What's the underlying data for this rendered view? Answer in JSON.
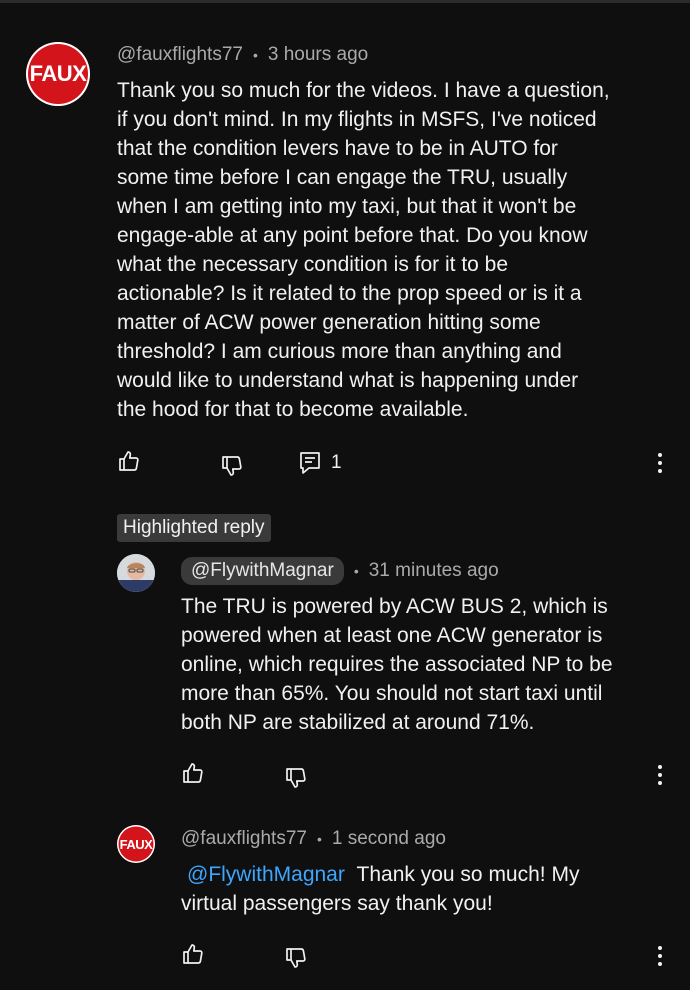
{
  "comment": {
    "avatar_text": "FAUX",
    "handle": "@fauxflights77",
    "time": "3 hours ago",
    "text": "Thank you so much for the videos. I have a question,\nif you don't mind. In my flights in MSFS, I've noticed\nthat the condition levers have to be in AUTO for\nsome time before I can engage the TRU, usually\nwhen I am getting into my taxi, but that it won't be\nengage-able at any point before that. Do you know\nwhat the necessary condition is for it to be\nactionable? Is it related to the prop speed or is it a\nmatter of ACW power generation hitting some\nthreshold? I am curious more than anything and\nwould like to understand what is happening under\nthe hood for that to become available.",
    "reply_count": "1"
  },
  "highlighted_label": "Highlighted reply",
  "reply1": {
    "handle": "@FlywithMagnar",
    "time": "31 minutes ago",
    "text": "The TRU is powered by ACW BUS 2, which is\npowered when at least one ACW generator is\nonline, which requires the associated NP to be\nmore than 65%. You should not start taxi until\nboth NP are stabilized at around 71%."
  },
  "reply2": {
    "avatar_text": "FAUX",
    "handle": "@fauxflights77",
    "time": "1 second ago",
    "mention": "@FlywithMagnar",
    "text_after_mention": "Thank you so much! My",
    "text_line2": "virtual passengers say thank you!"
  },
  "colors": {
    "background": "#0f0f0f",
    "mention": "#3ea6ff",
    "avatar_red": "#d4141b"
  },
  "icons": [
    "thumbs-up-icon",
    "thumbs-down-icon",
    "reply-icon",
    "more-vert-icon"
  ]
}
